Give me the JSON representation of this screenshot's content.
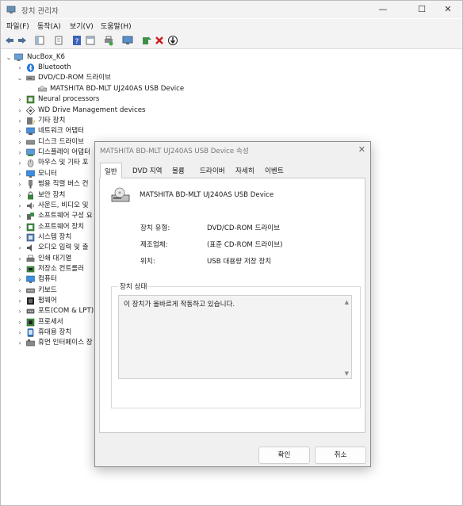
{
  "window": {
    "title": "장치 관리자",
    "controls": {
      "minimize": "—",
      "maximize": "☐",
      "close": "✕"
    }
  },
  "menu": [
    "파일(F)",
    "동작(A)",
    "보기(V)",
    "도움말(H)"
  ],
  "toolbar": {
    "icons": [
      "back-icon",
      "forward-icon",
      "show-hide-tree-icon",
      "properties-icon",
      "help-icon",
      "view-icon",
      "print-icon",
      "monitor-icon",
      "update-driver-icon",
      "uninstall-icon",
      "scan-download-icon"
    ]
  },
  "tree": {
    "root": "NucBox_K6",
    "items": [
      {
        "label": "Bluetooth",
        "expanded": false,
        "icon": "bluetooth-icon"
      },
      {
        "label": "DVD/CD-ROM 드라이브",
        "expanded": true,
        "icon": "dvd-drive-icon"
      },
      {
        "label": "MATSHITA BD-MLT UJ240AS USB Device",
        "child": true,
        "icon": "disc-device-icon"
      },
      {
        "label": "Neural processors",
        "expanded": false,
        "icon": "processor-icon"
      },
      {
        "label": "WD Drive Management devices",
        "expanded": false,
        "icon": "wd-device-icon"
      },
      {
        "label": "기타 장치",
        "expanded": false,
        "icon": "unknown-device-icon"
      },
      {
        "label": "네트워크 어댑터",
        "expanded": false,
        "icon": "network-adapter-icon"
      },
      {
        "label": "디스크 드라이브",
        "expanded": false,
        "icon": "disk-drive-icon"
      },
      {
        "label": "디스플레이 어댑터",
        "expanded": false,
        "icon": "display-adapter-icon"
      },
      {
        "label": "마우스 및 기타 포",
        "expanded": false,
        "icon": "mouse-icon"
      },
      {
        "label": "모니터",
        "expanded": false,
        "icon": "monitor-icon"
      },
      {
        "label": "범용 직렬 버스 컨",
        "expanded": false,
        "icon": "usb-icon"
      },
      {
        "label": "보안 장치",
        "expanded": false,
        "icon": "security-icon"
      },
      {
        "label": "사운드, 비디오 및",
        "expanded": false,
        "icon": "sound-icon"
      },
      {
        "label": "소프트웨어 구성 요",
        "expanded": false,
        "icon": "software-component-icon"
      },
      {
        "label": "소프트웨어 장치",
        "expanded": false,
        "icon": "software-device-icon"
      },
      {
        "label": "시스템 장치",
        "expanded": false,
        "icon": "system-device-icon"
      },
      {
        "label": "오디오 입력 및 출",
        "expanded": false,
        "icon": "audio-io-icon"
      },
      {
        "label": "인쇄 대기열",
        "expanded": false,
        "icon": "print-queue-icon"
      },
      {
        "label": "저장소 컨트롤러",
        "expanded": false,
        "icon": "storage-controller-icon"
      },
      {
        "label": "컴퓨터",
        "expanded": false,
        "icon": "computer-icon"
      },
      {
        "label": "키보드",
        "expanded": false,
        "icon": "keyboard-icon"
      },
      {
        "label": "펌웨어",
        "expanded": false,
        "icon": "firmware-icon"
      },
      {
        "label": "포트(COM & LPT)",
        "expanded": false,
        "icon": "port-icon"
      },
      {
        "label": "프로세서",
        "expanded": false,
        "icon": "cpu-icon"
      },
      {
        "label": "휴대용 장치",
        "expanded": false,
        "icon": "portable-device-icon"
      },
      {
        "label": "휴먼 인터페이스 장",
        "expanded": false,
        "icon": "hid-icon"
      }
    ]
  },
  "dialog": {
    "title": "MATSHITA BD-MLT UJ240AS USB Device 속성",
    "tabs": [
      "일반",
      "DVD 지역",
      "볼륨",
      "드라이버",
      "자세히",
      "이벤트"
    ],
    "device_name": "MATSHITA BD-MLT UJ240AS USB Device",
    "properties": [
      {
        "label": "장치 유형:",
        "value": "DVD/CD-ROM 드라이브"
      },
      {
        "label": "제조업체:",
        "value": "(표준 CD-ROM 드라이브)"
      },
      {
        "label": "위치:",
        "value": "USB 대용량 저장 장치"
      }
    ],
    "status_group_title": "장치 상태",
    "status_text": "이 장치가 올바르게 작동하고 있습니다.",
    "ok_label": "확인",
    "cancel_label": "취소"
  }
}
